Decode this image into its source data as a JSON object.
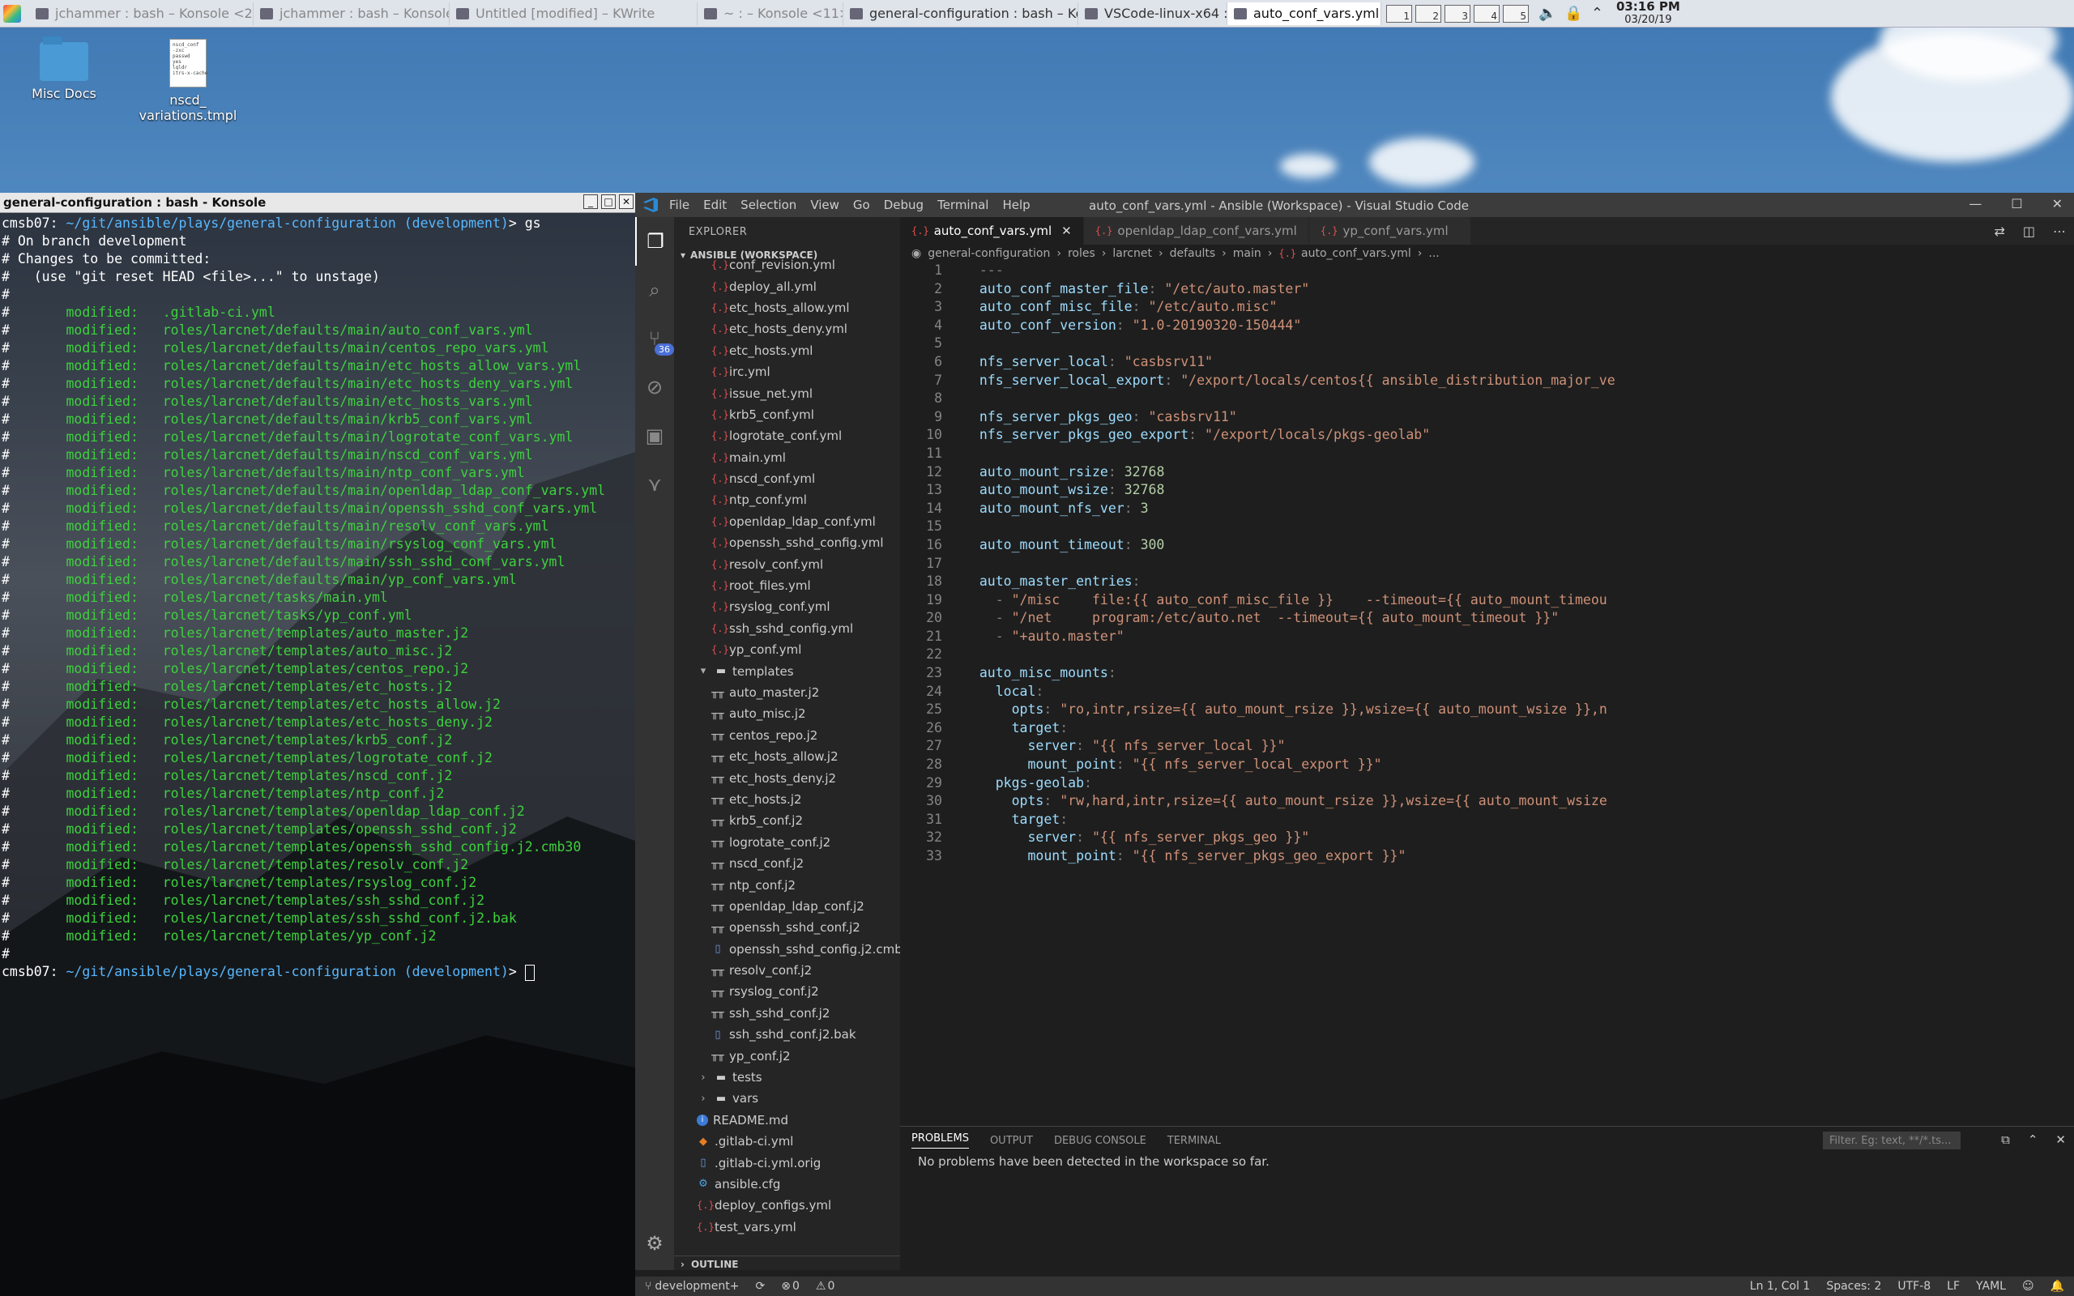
{
  "taskbar": {
    "tasks": [
      {
        "label": "jchammer : bash – Konsole <2>",
        "state": "dim"
      },
      {
        "label": "jchammer : bash – Konsole",
        "state": "dim"
      },
      {
        "label": "Untitled [modified] – KWrite",
        "state": "dim"
      },
      {
        "label": "~ : – Konsole <11>",
        "state": "dim"
      },
      {
        "label": "general-configuration : bash – Konsole",
        "state": "normal"
      },
      {
        "label": "VSCode-linux-x64 : bash – Konsole",
        "state": "normal"
      },
      {
        "label": "auto_conf_vars.yml · Ansible (Workspace)",
        "state": "active"
      }
    ],
    "pager": [
      "1",
      "2",
      "3",
      "4",
      "5"
    ],
    "clock_time": "03:16 PM",
    "clock_date": "03/20/19"
  },
  "desktop_icons": [
    {
      "label": "Misc Docs",
      "icon": "folder-icon"
    },
    {
      "label": "nscd_\nvariations.tmpl",
      "icon": "document-icon",
      "preview": "nscd_conf\n-zxc\npasswd\nyes\nlqldr\nitrs-x-cache"
    }
  ],
  "konsole": {
    "title": "general-configuration : bash - Konsole",
    "prompt_host": "cmsb07: ",
    "prompt_path": "~/git/ansible/plays/general-configuration (development)",
    "prompt_suffix": "> ",
    "command": "gs",
    "header_lines": [
      "# On branch development",
      "# Changes to be committed:",
      "#   (use \"git reset HEAD <file>...\" to unstage)",
      "#"
    ],
    "modified_label": "modified:",
    "modified_files": [
      ".gitlab-ci.yml",
      "roles/larcnet/defaults/main/auto_conf_vars.yml",
      "roles/larcnet/defaults/main/centos_repo_vars.yml",
      "roles/larcnet/defaults/main/etc_hosts_allow_vars.yml",
      "roles/larcnet/defaults/main/etc_hosts_deny_vars.yml",
      "roles/larcnet/defaults/main/etc_hosts_vars.yml",
      "roles/larcnet/defaults/main/krb5_conf_vars.yml",
      "roles/larcnet/defaults/main/logrotate_conf_vars.yml",
      "roles/larcnet/defaults/main/nscd_conf_vars.yml",
      "roles/larcnet/defaults/main/ntp_conf_vars.yml",
      "roles/larcnet/defaults/main/openldap_ldap_conf_vars.yml",
      "roles/larcnet/defaults/main/openssh_sshd_conf_vars.yml",
      "roles/larcnet/defaults/main/resolv_conf_vars.yml",
      "roles/larcnet/defaults/main/rsyslog_conf_vars.yml",
      "roles/larcnet/defaults/main/ssh_sshd_conf_vars.yml",
      "roles/larcnet/defaults/main/yp_conf_vars.yml",
      "roles/larcnet/tasks/main.yml",
      "roles/larcnet/tasks/yp_conf.yml",
      "roles/larcnet/templates/auto_master.j2",
      "roles/larcnet/templates/auto_misc.j2",
      "roles/larcnet/templates/centos_repo.j2",
      "roles/larcnet/templates/etc_hosts.j2",
      "roles/larcnet/templates/etc_hosts_allow.j2",
      "roles/larcnet/templates/etc_hosts_deny.j2",
      "roles/larcnet/templates/krb5_conf.j2",
      "roles/larcnet/templates/logrotate_conf.j2",
      "roles/larcnet/templates/nscd_conf.j2",
      "roles/larcnet/templates/ntp_conf.j2",
      "roles/larcnet/templates/openldap_ldap_conf.j2",
      "roles/larcnet/templates/openssh_sshd_conf.j2",
      "roles/larcnet/templates/openssh_sshd_config.j2.cmb30",
      "roles/larcnet/templates/resolv_conf.j2",
      "roles/larcnet/templates/rsyslog_conf.j2",
      "roles/larcnet/templates/ssh_sshd_conf.j2",
      "roles/larcnet/templates/ssh_sshd_conf.j2.bak",
      "roles/larcnet/templates/yp_conf.j2"
    ],
    "footer_line": "#"
  },
  "vscode": {
    "menu": [
      "File",
      "Edit",
      "Selection",
      "View",
      "Go",
      "Debug",
      "Terminal",
      "Help"
    ],
    "window_title": "auto_conf_vars.yml - Ansible (Workspace) - Visual Studio Code",
    "scm_badge": "36",
    "explorer_title": "EXPLORER",
    "workspace_label": "ANSIBLE (WORKSPACE)",
    "tree": [
      {
        "label": "conf_revision.yml",
        "icon": "yml",
        "indent": 2
      },
      {
        "label": "deploy_all.yml",
        "icon": "yml",
        "indent": 2
      },
      {
        "label": "etc_hosts_allow.yml",
        "icon": "yml",
        "indent": 2
      },
      {
        "label": "etc_hosts_deny.yml",
        "icon": "yml",
        "indent": 2
      },
      {
        "label": "etc_hosts.yml",
        "icon": "yml",
        "indent": 2
      },
      {
        "label": "irc.yml",
        "icon": "yml",
        "indent": 2
      },
      {
        "label": "issue_net.yml",
        "icon": "yml",
        "indent": 2
      },
      {
        "label": "krb5_conf.yml",
        "icon": "yml",
        "indent": 2
      },
      {
        "label": "logrotate_conf.yml",
        "icon": "yml",
        "indent": 2
      },
      {
        "label": "main.yml",
        "icon": "yml",
        "indent": 2
      },
      {
        "label": "nscd_conf.yml",
        "icon": "yml",
        "indent": 2
      },
      {
        "label": "ntp_conf.yml",
        "icon": "yml",
        "indent": 2
      },
      {
        "label": "openldap_ldap_conf.yml",
        "icon": "yml",
        "indent": 2
      },
      {
        "label": "openssh_sshd_config.yml",
        "icon": "yml",
        "indent": 2
      },
      {
        "label": "resolv_conf.yml",
        "icon": "yml",
        "indent": 2
      },
      {
        "label": "root_files.yml",
        "icon": "yml",
        "indent": 2
      },
      {
        "label": "rsyslog_conf.yml",
        "icon": "yml",
        "indent": 2
      },
      {
        "label": "ssh_sshd_config.yml",
        "icon": "yml",
        "indent": 2
      },
      {
        "label": "yp_conf.yml",
        "icon": "yml",
        "indent": 2
      },
      {
        "label": "templates",
        "icon": "folder-open",
        "indent": 1
      },
      {
        "label": "auto_master.j2",
        "icon": "j2",
        "indent": 2
      },
      {
        "label": "auto_misc.j2",
        "icon": "j2",
        "indent": 2
      },
      {
        "label": "centos_repo.j2",
        "icon": "j2",
        "indent": 2
      },
      {
        "label": "etc_hosts_allow.j2",
        "icon": "j2",
        "indent": 2
      },
      {
        "label": "etc_hosts_deny.j2",
        "icon": "j2",
        "indent": 2
      },
      {
        "label": "etc_hosts.j2",
        "icon": "j2",
        "indent": 2
      },
      {
        "label": "krb5_conf.j2",
        "icon": "j2",
        "indent": 2
      },
      {
        "label": "logrotate_conf.j2",
        "icon": "j2",
        "indent": 2
      },
      {
        "label": "nscd_conf.j2",
        "icon": "j2",
        "indent": 2
      },
      {
        "label": "ntp_conf.j2",
        "icon": "j2",
        "indent": 2
      },
      {
        "label": "openldap_ldap_conf.j2",
        "icon": "j2",
        "indent": 2
      },
      {
        "label": "openssh_sshd_conf.j2",
        "icon": "j2",
        "indent": 2
      },
      {
        "label": "openssh_sshd_config.j2.cmb30",
        "icon": "file",
        "indent": 2
      },
      {
        "label": "resolv_conf.j2",
        "icon": "j2",
        "indent": 2
      },
      {
        "label": "rsyslog_conf.j2",
        "icon": "j2",
        "indent": 2
      },
      {
        "label": "ssh_sshd_conf.j2",
        "icon": "j2",
        "indent": 2
      },
      {
        "label": "ssh_sshd_conf.j2.bak",
        "icon": "file",
        "indent": 2
      },
      {
        "label": "yp_conf.j2",
        "icon": "j2",
        "indent": 2
      },
      {
        "label": "tests",
        "icon": "folder-closed",
        "indent": 1
      },
      {
        "label": "vars",
        "icon": "folder-closed",
        "indent": 1
      },
      {
        "label": "README.md",
        "icon": "info",
        "indent": 1
      },
      {
        "label": ".gitlab-ci.yml",
        "icon": "gitlab",
        "indent": 0
      },
      {
        "label": ".gitlab-ci.yml.orig",
        "icon": "file",
        "indent": 0
      },
      {
        "label": "ansible.cfg",
        "icon": "gear",
        "indent": 0
      },
      {
        "label": "deploy_configs.yml",
        "icon": "yml",
        "indent": 0
      },
      {
        "label": "test_vars.yml",
        "icon": "yml",
        "indent": 0
      }
    ],
    "outline_label": "OUTLINE",
    "tabs": [
      {
        "label": "auto_conf_vars.yml",
        "active": true
      },
      {
        "label": "openldap_ldap_conf_vars.yml",
        "active": false
      },
      {
        "label": "yp_conf_vars.yml",
        "active": false
      }
    ],
    "breadcrumb": [
      "general-configuration",
      "roles",
      "larcnet",
      "defaults",
      "main",
      "auto_conf_vars.yml",
      "..."
    ],
    "code_lines": [
      [
        [
          "p",
          "---"
        ]
      ],
      [
        [
          "k",
          "auto_conf_master_file"
        ],
        [
          "p",
          ": "
        ],
        [
          "s",
          "\"/etc/auto.master\""
        ]
      ],
      [
        [
          "k",
          "auto_conf_misc_file"
        ],
        [
          "p",
          ": "
        ],
        [
          "s",
          "\"/etc/auto.misc\""
        ]
      ],
      [
        [
          "k",
          "auto_conf_version"
        ],
        [
          "p",
          ": "
        ],
        [
          "s",
          "\"1.0-20190320-150444\""
        ]
      ],
      [],
      [
        [
          "k",
          "nfs_server_local"
        ],
        [
          "p",
          ": "
        ],
        [
          "s",
          "\"casbsrv11\""
        ]
      ],
      [
        [
          "k",
          "nfs_server_local_export"
        ],
        [
          "p",
          ": "
        ],
        [
          "s",
          "\"/export/locals/centos{{ ansible_distribution_major_ve"
        ]
      ],
      [],
      [
        [
          "k",
          "nfs_server_pkgs_geo"
        ],
        [
          "p",
          ": "
        ],
        [
          "s",
          "\"casbsrv11\""
        ]
      ],
      [
        [
          "k",
          "nfs_server_pkgs_geo_export"
        ],
        [
          "p",
          ": "
        ],
        [
          "s",
          "\"/export/locals/pkgs-geolab\""
        ]
      ],
      [],
      [
        [
          "k",
          "auto_mount_rsize"
        ],
        [
          "p",
          ": "
        ],
        [
          "n",
          "32768"
        ]
      ],
      [
        [
          "k",
          "auto_mount_wsize"
        ],
        [
          "p",
          ": "
        ],
        [
          "n",
          "32768"
        ]
      ],
      [
        [
          "k",
          "auto_mount_nfs_ver"
        ],
        [
          "p",
          ": "
        ],
        [
          "n",
          "3"
        ]
      ],
      [],
      [
        [
          "k",
          "auto_mount_timeout"
        ],
        [
          "p",
          ": "
        ],
        [
          "n",
          "300"
        ]
      ],
      [],
      [
        [
          "k",
          "auto_master_entries"
        ],
        [
          "p",
          ":"
        ]
      ],
      [
        [
          "p",
          "  - "
        ],
        [
          "s",
          "\"/misc    file:{{ auto_conf_misc_file }}    --timeout={{ auto_mount_timeou"
        ]
      ],
      [
        [
          "p",
          "  - "
        ],
        [
          "s",
          "\"/net     program:/etc/auto.net  --timeout={{ auto_mount_timeout }}\""
        ]
      ],
      [
        [
          "p",
          "  - "
        ],
        [
          "s",
          "\"+auto.master\""
        ]
      ],
      [],
      [
        [
          "k",
          "auto_misc_mounts"
        ],
        [
          "p",
          ":"
        ]
      ],
      [
        [
          "p",
          "  "
        ],
        [
          "k",
          "local"
        ],
        [
          "p",
          ":"
        ]
      ],
      [
        [
          "p",
          "    "
        ],
        [
          "k",
          "opts"
        ],
        [
          "p",
          ": "
        ],
        [
          "s",
          "\"ro,intr,rsize={{ auto_mount_rsize }},wsize={{ auto_mount_wsize }},n"
        ]
      ],
      [
        [
          "p",
          "    "
        ],
        [
          "k",
          "target"
        ],
        [
          "p",
          ":"
        ]
      ],
      [
        [
          "p",
          "      "
        ],
        [
          "k",
          "server"
        ],
        [
          "p",
          ": "
        ],
        [
          "s",
          "\"{{ nfs_server_local }}\""
        ]
      ],
      [
        [
          "p",
          "      "
        ],
        [
          "k",
          "mount_point"
        ],
        [
          "p",
          ": "
        ],
        [
          "s",
          "\"{{ nfs_server_local_export }}\""
        ]
      ],
      [
        [
          "p",
          "  "
        ],
        [
          "k",
          "pkgs-geolab"
        ],
        [
          "p",
          ":"
        ]
      ],
      [
        [
          "p",
          "    "
        ],
        [
          "k",
          "opts"
        ],
        [
          "p",
          ": "
        ],
        [
          "s",
          "\"rw,hard,intr,rsize={{ auto_mount_rsize }},wsize={{ auto_mount_wsize"
        ]
      ],
      [
        [
          "p",
          "    "
        ],
        [
          "k",
          "target"
        ],
        [
          "p",
          ":"
        ]
      ],
      [
        [
          "p",
          "      "
        ],
        [
          "k",
          "server"
        ],
        [
          "p",
          ": "
        ],
        [
          "s",
          "\"{{ nfs_server_pkgs_geo }}\""
        ]
      ],
      [
        [
          "p",
          "      "
        ],
        [
          "k",
          "mount_point"
        ],
        [
          "p",
          ": "
        ],
        [
          "s",
          "\"{{ nfs_server_pkgs_geo_export }}\""
        ]
      ]
    ],
    "panel_tabs": [
      "PROBLEMS",
      "OUTPUT",
      "DEBUG CONSOLE",
      "TERMINAL"
    ],
    "panel_filter_placeholder": "Filter. Eg: text, **/*.ts...",
    "panel_message": "No problems have been detected in the workspace so far.",
    "status": {
      "branch": "development+",
      "errors": "0",
      "warnings": "0",
      "position": "Ln 1, Col 1",
      "spaces": "Spaces: 2",
      "encoding": "UTF-8",
      "eol": "LF",
      "language": "YAML"
    }
  }
}
